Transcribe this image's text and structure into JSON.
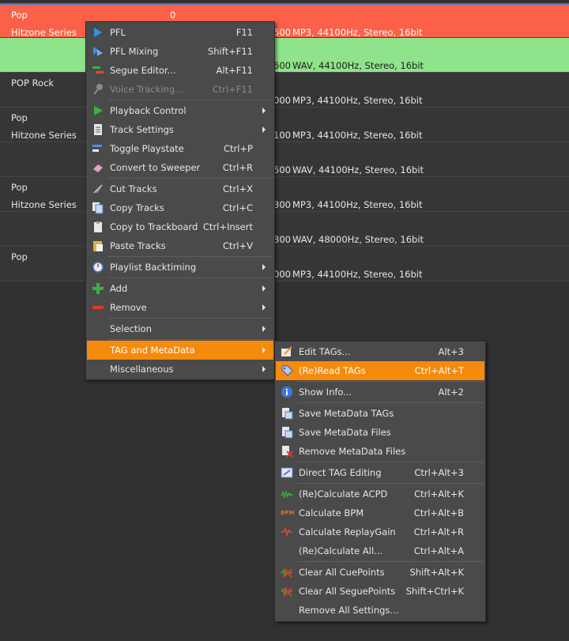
{
  "rows": [
    {
      "line1": "Pop",
      "num": "0",
      "line2": "Hitzone Series",
      "fmt_suffix": "500",
      "format": "MP3, 44100Hz, Stereo, 16bit"
    },
    {
      "line1": "",
      "line2": "",
      "fmt_suffix": "600",
      "format": "WAV, 44100Hz, Stereo, 16bit"
    },
    {
      "line1": "POP   Rock",
      "line2": "",
      "fmt_suffix": "000",
      "format": "MP3, 44100Hz, Stereo, 16bit"
    },
    {
      "line1": "Pop",
      "line2": "Hitzone Series",
      "fmt_suffix": "100",
      "format": "MP3, 44100Hz, Stereo, 16bit"
    },
    {
      "line1": "",
      "line2": "",
      "fmt_suffix": "500",
      "format": "WAV, 44100Hz, Stereo, 16bit"
    },
    {
      "line1": "Pop",
      "line2": "Hitzone Series",
      "fmt_suffix": "300",
      "format": "MP3, 44100Hz, Stereo, 16bit"
    },
    {
      "line1": "",
      "line2": "",
      "fmt_suffix": "300",
      "format": "WAV, 48000Hz, Stereo, 16bit"
    },
    {
      "line1": "Pop",
      "line2": "",
      "fmt_suffix": "000",
      "format": "MP3, 44100Hz, Stereo, 16bit"
    }
  ],
  "colors": {
    "highlight": "#f58a0c",
    "row_red": "#fa6148",
    "row_green": "#8fe38a"
  },
  "main_menu": [
    {
      "label": "PFL",
      "shortcut": "F11",
      "icon": "play-blue-icon"
    },
    {
      "label": "PFL Mixing",
      "shortcut": "Shift+F11",
      "icon": "pfl-mixing-icon"
    },
    {
      "label": "Segue Editor...",
      "shortcut": "Alt+F11",
      "icon": "segue-editor-icon"
    },
    {
      "label": "Voice Tracking...",
      "shortcut": "Ctrl+F11",
      "icon": "microphone-icon",
      "disabled": true
    },
    {
      "label": "Playback Control",
      "icon": "play-green-icon",
      "submenu": true
    },
    {
      "label": "Track Settings",
      "icon": "track-settings-icon",
      "submenu": true
    },
    {
      "label": "Toggle Playstate",
      "shortcut": "Ctrl+P",
      "icon": "toggle-playstate-icon"
    },
    {
      "label": "Convert to Sweeper",
      "shortcut": "Ctrl+R",
      "icon": "eraser-icon"
    },
    {
      "label": "Cut Tracks",
      "shortcut": "Ctrl+X",
      "icon": "scissors-icon"
    },
    {
      "label": "Copy Tracks",
      "shortcut": "Ctrl+C",
      "icon": "copy-icon"
    },
    {
      "label": "Copy to Trackboard",
      "shortcut": "Ctrl+Insert",
      "icon": "trackboard-icon"
    },
    {
      "label": "Paste Tracks",
      "shortcut": "Ctrl+V",
      "icon": "paste-icon"
    },
    {
      "label": "Playlist Backtiming",
      "icon": "backtiming-icon",
      "submenu": true
    },
    {
      "label": "Add",
      "icon": "plus-icon",
      "submenu": true
    },
    {
      "label": "Remove",
      "icon": "minus-icon",
      "submenu": true
    },
    {
      "label": "Selection",
      "submenu": true
    },
    {
      "label": "TAG and MetaData",
      "submenu": true,
      "highlighted": true
    },
    {
      "label": "Miscellaneous",
      "submenu": true
    }
  ],
  "sub_menu": [
    {
      "label": "Edit TAGs...",
      "shortcut": "Alt+3",
      "icon": "edit-tags-icon"
    },
    {
      "label": "(Re)Read TAGs",
      "shortcut": "Ctrl+Alt+T",
      "icon": "tag-icon",
      "highlighted": true
    },
    {
      "label": "Show Info...",
      "shortcut": "Alt+2",
      "icon": "info-icon"
    },
    {
      "label": "Save MetaData TAGs",
      "icon": "save-tags-icon"
    },
    {
      "label": "Save MetaData Files",
      "icon": "save-files-icon"
    },
    {
      "label": "Remove MetaData Files",
      "icon": "remove-files-icon"
    },
    {
      "label": "Direct TAG Editing",
      "shortcut": "Ctrl+Alt+3",
      "icon": "direct-edit-icon"
    },
    {
      "label": "(Re)Calculate ACPD",
      "shortcut": "Ctrl+Alt+K",
      "icon": "acpd-icon"
    },
    {
      "label": "Calculate BPM",
      "shortcut": "Ctrl+Alt+B",
      "icon": "bpm-icon",
      "icon_text": "BPM"
    },
    {
      "label": "Calculate ReplayGain",
      "shortcut": "Ctrl+Alt+R",
      "icon": "replaygain-icon"
    },
    {
      "label": "(Re)Calculate All...",
      "shortcut": "Ctrl+Alt+A"
    },
    {
      "label": "Clear All CuePoints",
      "shortcut": "Shift+Alt+K",
      "icon": "clear-cuepoints-icon"
    },
    {
      "label": "Clear All SeguePoints",
      "shortcut": "Shift+Ctrl+K",
      "icon": "clear-seguepoints-icon"
    },
    {
      "label": "Remove All Settings..."
    }
  ]
}
